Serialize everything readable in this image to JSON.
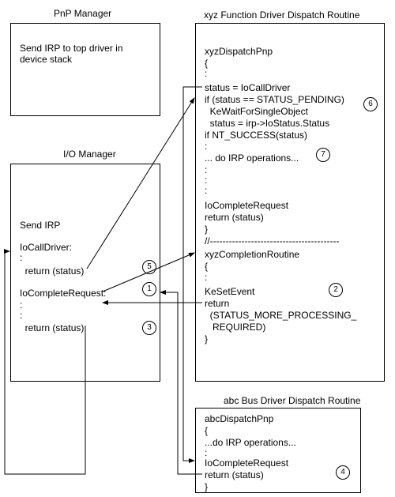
{
  "titles": {
    "pnp": "PnP Manager",
    "io": "I/O Manager",
    "xyz": "xyz Function Driver Dispatch Routine",
    "abc": "abc Bus Driver Dispatch Routine"
  },
  "pnp": {
    "line1": "Send IRP to top driver in",
    "line2": "device stack"
  },
  "io": {
    "sendirp": "Send IRP",
    "iocall": "IoCallDriver:",
    "ret1": "  return (status)",
    "iocomplete": "IoCompleteRequest:",
    "ret2": "  return (status)"
  },
  "xyz": {
    "l1": "xyzDispatchPnp",
    "l2": "{",
    "l3": "status = IoCallDriver",
    "l4": "if (status == STATUS_PENDING)",
    "l5": "  KeWaitForSingleObject",
    "l6": "  status = irp->IoStatus.Status",
    "l7": "if NT_SUCCESS(status)",
    "l8": "... do IRP operations...",
    "l9": "IoCompleteRequest",
    "l10": "return (status)",
    "l11": "}",
    "l12": "//-----------------------------------------",
    "l13": "xyzCompletionRoutine",
    "l14": "{",
    "l15": "KeSetEvent",
    "l16": "return",
    "l17": "  (STATUS_MORE_PROCESSING_",
    "l18": "   REQUIRED)",
    "l19": "}"
  },
  "abc": {
    "l1": "abcDispatchPnp",
    "l2": "{",
    "l3": "...do IRP operations...",
    "l4": "IoCompleteRequest",
    "l5": "return (status)",
    "l6": "}"
  },
  "steps": {
    "s1": "1",
    "s2": "2",
    "s3": "3",
    "s4": "4",
    "s5": "5",
    "s6": "6",
    "s7": "7"
  }
}
